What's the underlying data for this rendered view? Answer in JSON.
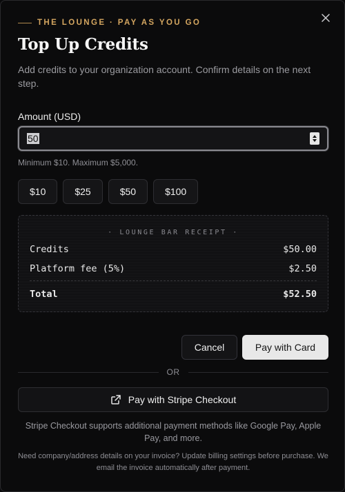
{
  "dialog": {
    "eyebrow": "THE LOUNGE · PAY AS YOU GO",
    "title": "Top Up Credits",
    "subtitle": "Add credits to your organization account. Confirm details on the next step.",
    "close_icon": "close-icon"
  },
  "amount": {
    "label": "Amount (USD)",
    "value": "50",
    "hint": "Minimum $10. Maximum $5,000."
  },
  "presets": [
    "$10",
    "$25",
    "$50",
    "$100"
  ],
  "receipt": {
    "title": "· LOUNGE BAR RECEIPT ·",
    "rows": [
      {
        "label": "Credits",
        "value": "$50.00"
      },
      {
        "label": "Platform fee (5%)",
        "value": "$2.50"
      }
    ],
    "total": {
      "label": "Total",
      "value": "$52.50"
    }
  },
  "actions": {
    "cancel": "Cancel",
    "pay_card": "Pay with Card",
    "or": "OR",
    "stripe": "Pay with Stripe Checkout",
    "stripe_icon": "external-link-icon"
  },
  "notes": {
    "stripe_note": "Stripe Checkout supports additional payment methods like Google Pay, Apple Pay, and more.",
    "billing_note": "Need company/address details on your invoice? Update billing settings before purchase. We email the invoice automatically after payment."
  },
  "colors": {
    "accent_gold": "#d4a660",
    "background": "#0b0b0c",
    "primary_button": "#e8e8e8"
  }
}
